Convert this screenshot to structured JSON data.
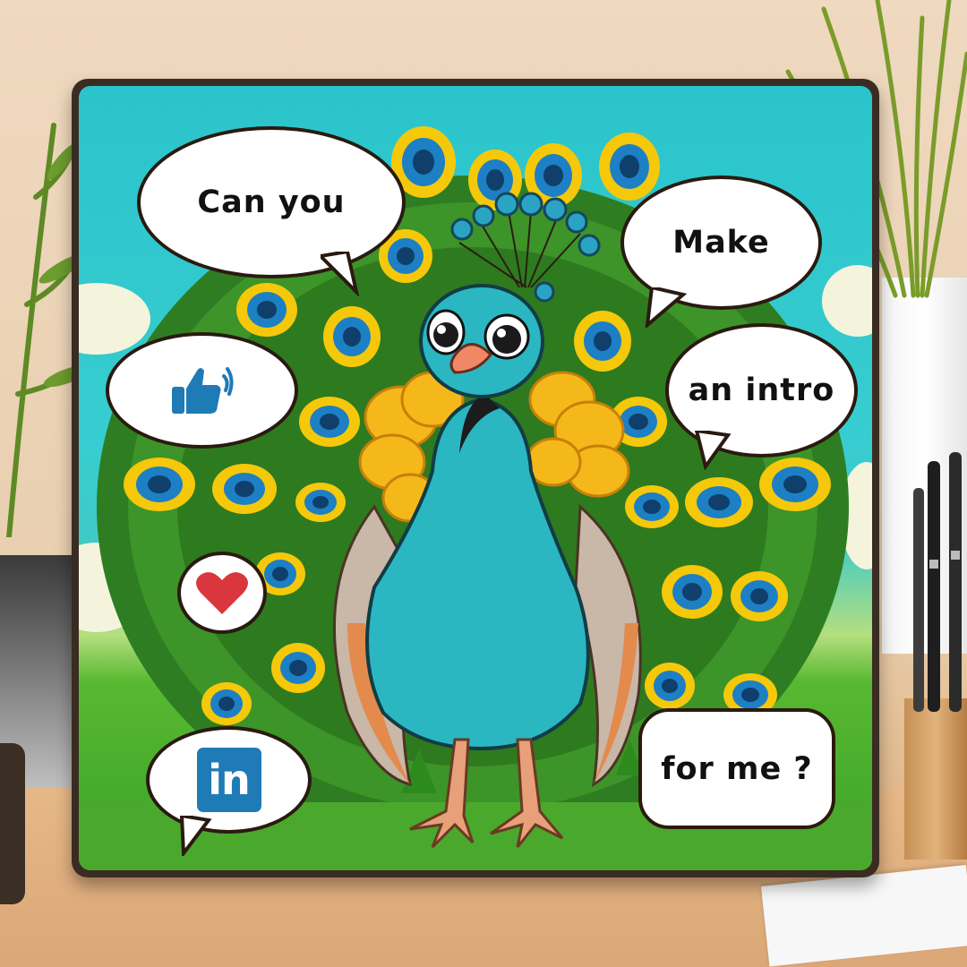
{
  "bubbles": {
    "top_left": "Can you",
    "top_right": "Make",
    "middle_right": "an intro",
    "bottom_right": "for me ?"
  },
  "icons": {
    "thumbs": "thumbs-up-icon",
    "heart": "heart-icon",
    "linkedin": "linkedin-icon",
    "linkedin_text": "in"
  },
  "colors": {
    "sky": "#2bc4cc",
    "grass": "#3aa22a",
    "bird_body": "#2ab7c2",
    "linkedin_blue": "#1f7bb6",
    "heart_red": "#d9363e",
    "bubble_outline": "#2a1a10"
  }
}
